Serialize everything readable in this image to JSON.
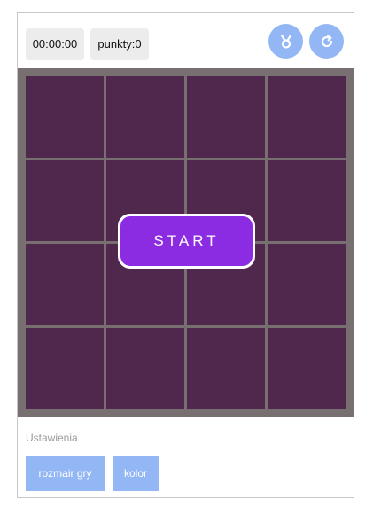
{
  "topbar": {
    "timer": "00:00:00",
    "score": "punkty:0",
    "icons": [
      "medal-icon",
      "reset-icon"
    ]
  },
  "board": {
    "rows": 4,
    "cols": 4,
    "tile_color": "#51284d",
    "frame_color": "#787070",
    "start_label": "START",
    "start_color": "#8b2be2"
  },
  "settings": {
    "label": "Ustawienia",
    "size_button": "rozmair gry",
    "color_button": "kolor",
    "button_color": "#93b6f5"
  }
}
